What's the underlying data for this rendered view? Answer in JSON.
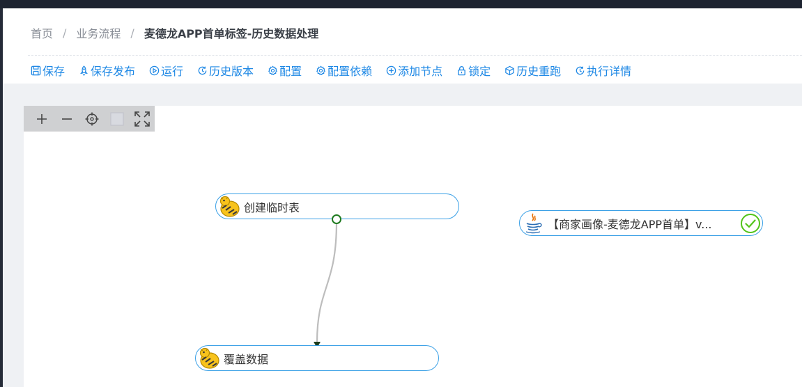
{
  "breadcrumb": {
    "home": "首页",
    "section": "业务流程",
    "current": "麦德龙APP首单标签-历史数据处理",
    "separator": "/"
  },
  "toolbar": [
    {
      "label": "保存",
      "icon": "save-icon"
    },
    {
      "label": "保存发布",
      "icon": "rocket-icon"
    },
    {
      "label": "运行",
      "icon": "play-icon"
    },
    {
      "label": "历史版本",
      "icon": "history-icon"
    },
    {
      "label": "配置",
      "icon": "gear-icon"
    },
    {
      "label": "配置依赖",
      "icon": "gear-icon"
    },
    {
      "label": "添加节点",
      "icon": "plus-circle-icon"
    },
    {
      "label": "锁定",
      "icon": "lock-icon"
    },
    {
      "label": "历史重跑",
      "icon": "cube-icon"
    },
    {
      "label": "执行详情",
      "icon": "clock-icon"
    }
  ],
  "zoom_controls": [
    "zoom-in-icon",
    "zoom-out-icon",
    "locate-icon",
    "fit-box-icon",
    "fullscreen-icon"
  ],
  "nodes": {
    "create_temp": {
      "label": "创建临时表",
      "type": "hive-icon"
    },
    "overwrite": {
      "label": "覆盖数据",
      "type": "hive-icon"
    },
    "merchant": {
      "label": "【商家画像-麦德龙APP首单】v...",
      "type": "java-icon",
      "status": "success-check-icon"
    }
  },
  "colors": {
    "accent": "#1e88e5",
    "node_border": "#3aa0e6",
    "port": "#1f7a1f",
    "success": "#52c41a",
    "edge": "#bdbdbd"
  }
}
